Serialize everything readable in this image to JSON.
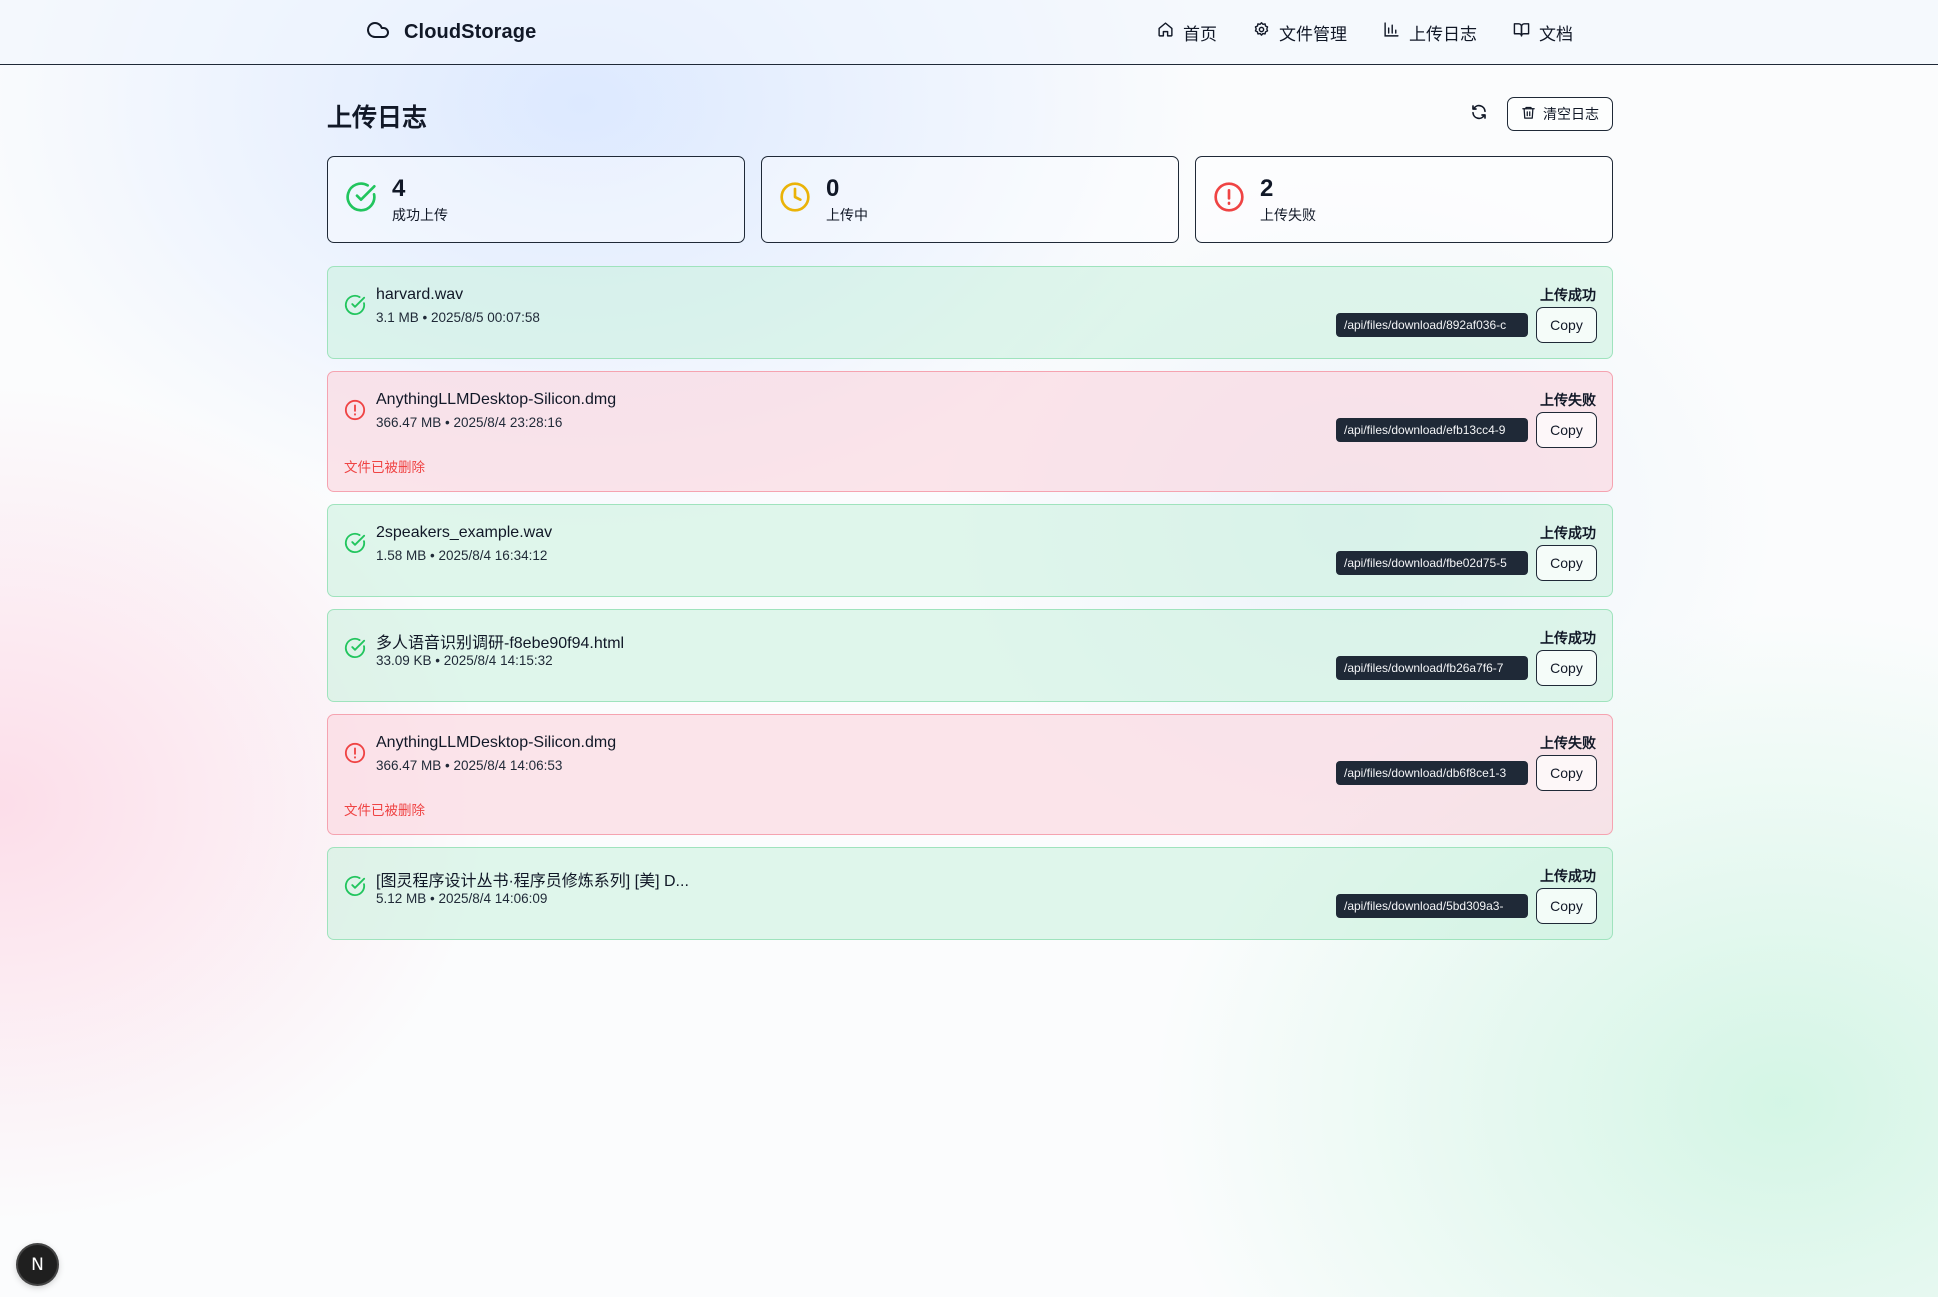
{
  "app": {
    "name": "CloudStorage",
    "logo_icon": "cloud-icon"
  },
  "nav": [
    {
      "label": "首页",
      "icon": "home-icon"
    },
    {
      "label": "文件管理",
      "icon": "gear-icon"
    },
    {
      "label": "上传日志",
      "icon": "bar-chart-icon"
    },
    {
      "label": "文档",
      "icon": "book-icon"
    }
  ],
  "page": {
    "title": "上传日志",
    "clear_label": "清空日志"
  },
  "stats": [
    {
      "value": "4",
      "label": "成功上传",
      "color": "#22c55e",
      "icon": "check-circle-icon"
    },
    {
      "value": "0",
      "label": "上传中",
      "color": "#eab308",
      "icon": "clock-icon"
    },
    {
      "value": "2",
      "label": "上传失败",
      "color": "#ef4444",
      "icon": "alert-circle-icon"
    }
  ],
  "logs": [
    {
      "status": "ok",
      "name": "harvard.wav",
      "meta": "3.1 MB • 2025/8/5 00:07:58",
      "status_text": "上传成功",
      "url": "/api/files/download/892af036-c",
      "copy": "Copy"
    },
    {
      "status": "fail",
      "name": "AnythingLLMDesktop-Silicon.dmg",
      "meta": "366.47 MB • 2025/8/4 23:28:16",
      "status_text": "上传失败",
      "url": "/api/files/download/efb13cc4-9",
      "copy": "Copy",
      "error": "文件已被删除"
    },
    {
      "status": "ok",
      "name": "2speakers_example.wav",
      "meta": "1.58 MB • 2025/8/4 16:34:12",
      "status_text": "上传成功",
      "url": "/api/files/download/fbe02d75-5",
      "copy": "Copy"
    },
    {
      "status": "ok",
      "name": "多人语音识别调研-f8ebe90f94.html",
      "meta": "33.09 KB • 2025/8/4 14:15:32",
      "status_text": "上传成功",
      "url": "/api/files/download/fb26a7f6-7",
      "copy": "Copy"
    },
    {
      "status": "fail",
      "name": "AnythingLLMDesktop-Silicon.dmg",
      "meta": "366.47 MB • 2025/8/4 14:06:53",
      "status_text": "上传失败",
      "url": "/api/files/download/db6f8ce1-3",
      "copy": "Copy",
      "error": "文件已被删除"
    },
    {
      "status": "ok",
      "name": "[图灵程序设计丛书·程序员修炼系列] [美] D...",
      "meta": "5.12 MB • 2025/8/4 14:06:09",
      "status_text": "上传成功",
      "url": "/api/files/download/5bd309a3-",
      "copy": "Copy"
    }
  ],
  "colors": {
    "success": "#22c55e",
    "pending": "#eab308",
    "failure": "#ef4444"
  },
  "dev_badge": "N"
}
